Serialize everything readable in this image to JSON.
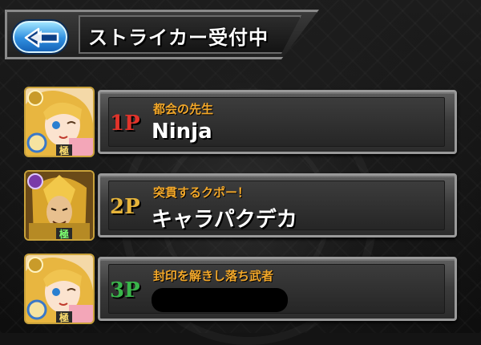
{
  "header": {
    "title": "ストライカー受付中",
    "back_button_icon": "back-arrow-icon"
  },
  "players": [
    {
      "number": "1P",
      "number_color": "#e2332a",
      "subtitle": "都会の先生",
      "name": "Ninja",
      "name_hidden": false,
      "badge": "極"
    },
    {
      "number": "2P",
      "number_color": "#e6b43a",
      "subtitle": "突貫するクポー！",
      "name": "キャラパクデカ",
      "name_hidden": false,
      "badge": "極"
    },
    {
      "number": "3P",
      "number_color": "#39b54a",
      "subtitle": "封印を解きし落ち武者",
      "name": "",
      "name_hidden": true,
      "badge": "極"
    }
  ],
  "colors": {
    "accent_blue": "#2f8fe0",
    "subtitle_orange": "#f3a82a",
    "panel_border": "#9a9a9a"
  }
}
